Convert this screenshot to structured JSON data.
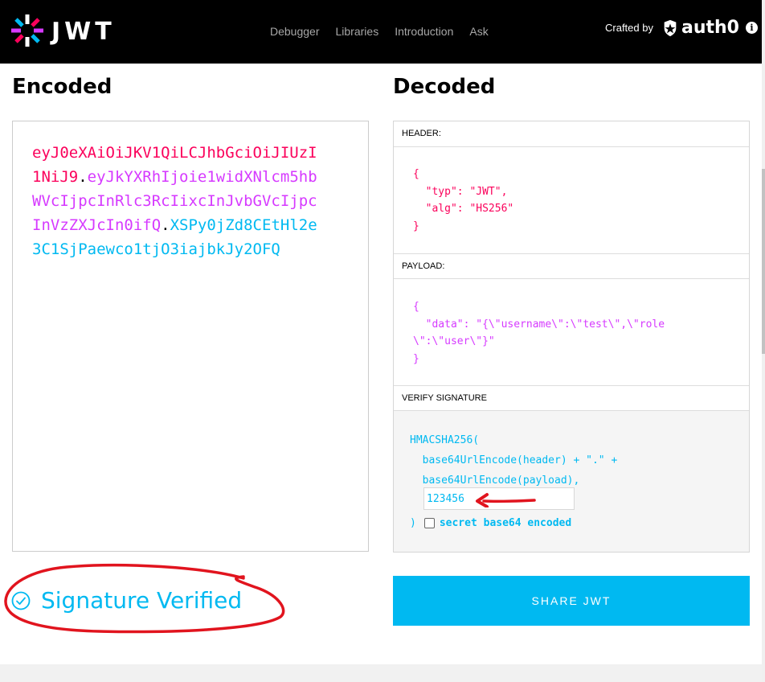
{
  "brand": {
    "logo_text": "JWT",
    "crafted_label": "Crafted by",
    "partner_name": "auth0",
    "info_icon": "i"
  },
  "nav": {
    "items": [
      "Debugger",
      "Libraries",
      "Introduction",
      "Ask"
    ]
  },
  "encoded": {
    "title": "Encoded",
    "header_part": "eyJ0eXAiOiJKV1QiLCJhbGciOiJIUzI1NiJ9",
    "payload_part": "eyJkYXRhIjoie1widXNlcm5hbWVcIjpcInRlc3RcIixcInJvbGVcIjpcInVzZXJcIn0ifQ",
    "signature_part": "XSPy0jZd8CEtHl2e3C1SjPaewco1tjO3iajbkJy2OFQ",
    "dot": "."
  },
  "decoded": {
    "title": "Decoded",
    "header_label": "HEADER:",
    "header_json": "{\n  \"typ\": \"JWT\",\n  \"alg\": \"HS256\"\n}",
    "payload_label": "PAYLOAD:",
    "payload_json": "{\n  \"data\": \"{\\\"username\\\":\\\"test\\\",\\\"role\n\\\":\\\"user\\\"}\"\n}",
    "verify_label": "VERIFY SIGNATURE",
    "verify_code": "HMACSHA256(\n  base64UrlEncode(header) + \".\" +\n  base64UrlEncode(payload),",
    "secret_value": "123456",
    "close_paren": ")",
    "secret_b64_label": "secret base64 encoded"
  },
  "status": {
    "verified_text": "Signature Verified"
  },
  "share_button": "SHARE JWT",
  "colors": {
    "header": "#fb015b",
    "payload": "#d63aff",
    "signature": "#00b9f1",
    "annotation": "#e1141e"
  },
  "icons": [
    "jwt-logo-icon",
    "auth0-shield-icon",
    "info-icon",
    "check-circle-icon",
    "red-arrow-annotation",
    "red-circle-annotation"
  ]
}
